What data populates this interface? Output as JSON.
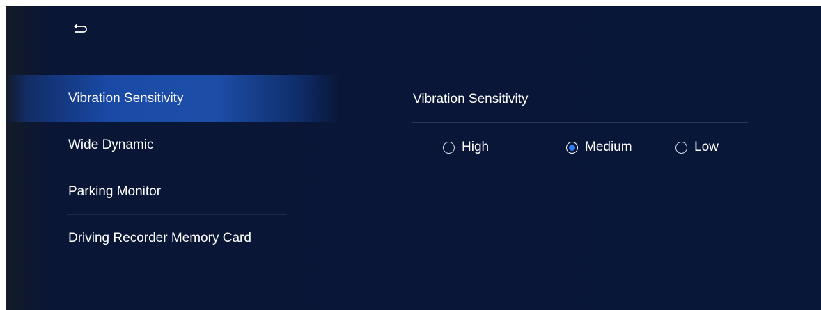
{
  "header": {
    "back_icon": "back-arrow-icon"
  },
  "menu": {
    "items": [
      {
        "label": "Vibration Sensitivity",
        "active": true
      },
      {
        "label": "Wide Dynamic",
        "active": false
      },
      {
        "label": "Parking Monitor",
        "active": false
      },
      {
        "label": "Driving Recorder Memory Card",
        "active": false
      }
    ]
  },
  "panel": {
    "title": "Vibration Sensitivity",
    "options": [
      {
        "label": "High",
        "selected": false
      },
      {
        "label": "Medium",
        "selected": true
      },
      {
        "label": "Low",
        "selected": false
      }
    ]
  },
  "colors": {
    "background": "#081638",
    "active_item": "#1c4ea8",
    "radio_selected": "#2f7df0",
    "text": "#ffffff"
  }
}
